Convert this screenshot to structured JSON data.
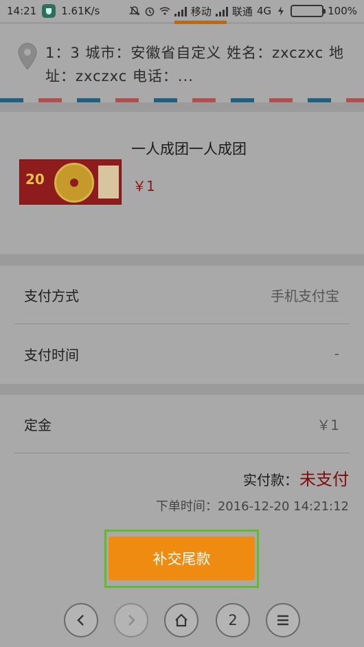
{
  "status_bar": {
    "time": "14:21",
    "speed": "1.61K/s",
    "carrier1": "移动",
    "carrier2": "联通",
    "network": "4G",
    "battery": "100%"
  },
  "address": {
    "text": "1：3 城市：安徽省自定义 姓名：zxczxc 地址：zxczxc 电话：..."
  },
  "product": {
    "title": "一人成团一人成团",
    "price": "￥1",
    "thumb_number": "20"
  },
  "payment": {
    "method_label": "支付方式",
    "method_value": "手机支付宝",
    "time_label": "支付时间",
    "time_value": "-"
  },
  "deposit": {
    "label": "定金",
    "value": "￥1",
    "actual_label": "实付款：",
    "actual_status": "未支付",
    "order_time_label": "下单时间：",
    "order_time_value": "2016-12-20 14:21:12"
  },
  "action": {
    "pay_balance_label": "补交尾款"
  },
  "nav": {
    "tabs_count": "2"
  },
  "colors": {
    "accent_button": "#f08b12",
    "status_red": "#7f0c0c"
  }
}
